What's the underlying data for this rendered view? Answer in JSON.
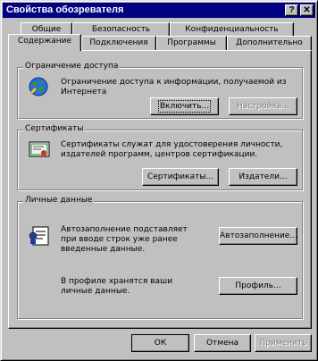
{
  "window": {
    "title": "Свойства обозревателя",
    "help_glyph": "?",
    "close_glyph": "✕"
  },
  "tabs_back": [
    "Общие",
    "Безопасность",
    "Конфиденциальность"
  ],
  "tabs_front": [
    "Содержание",
    "Подключения",
    "Программы",
    "Дополнительно"
  ],
  "active_tab": "Содержание",
  "content_advisor": {
    "legend": "Ограничение доступа",
    "description": "Ограничение доступа к информации, получаемой из Интернета",
    "enable_button": "Включить...",
    "settings_button": "Настройка..."
  },
  "certificates": {
    "legend": "Сертификаты",
    "description": "Сертификаты служат для удостоверения личности, издателей программ, центров сертификации.",
    "certificates_button": "Сертификаты...",
    "publishers_button": "Издатели..."
  },
  "personal_info": {
    "legend": "Личные данные",
    "autocomplete_text": "Автозаполнение подставляет при вводе строк уже ранее введенные данные.",
    "autocomplete_button": "Автозаполнение...",
    "profile_text": "В профиле хранятся ваши личные данные.",
    "profile_button": "Профиль..."
  },
  "footer": {
    "ok_button": "ОК",
    "cancel_button": "Отмена",
    "apply_button": "Применить"
  },
  "colors": {
    "titlebar": "#000080",
    "face": "#c0c0c0",
    "disabled_text": "#808080"
  },
  "icons": [
    "globe-icon",
    "certificate-icon",
    "autocomplete-card-icon",
    "help-icon",
    "close-icon"
  ]
}
